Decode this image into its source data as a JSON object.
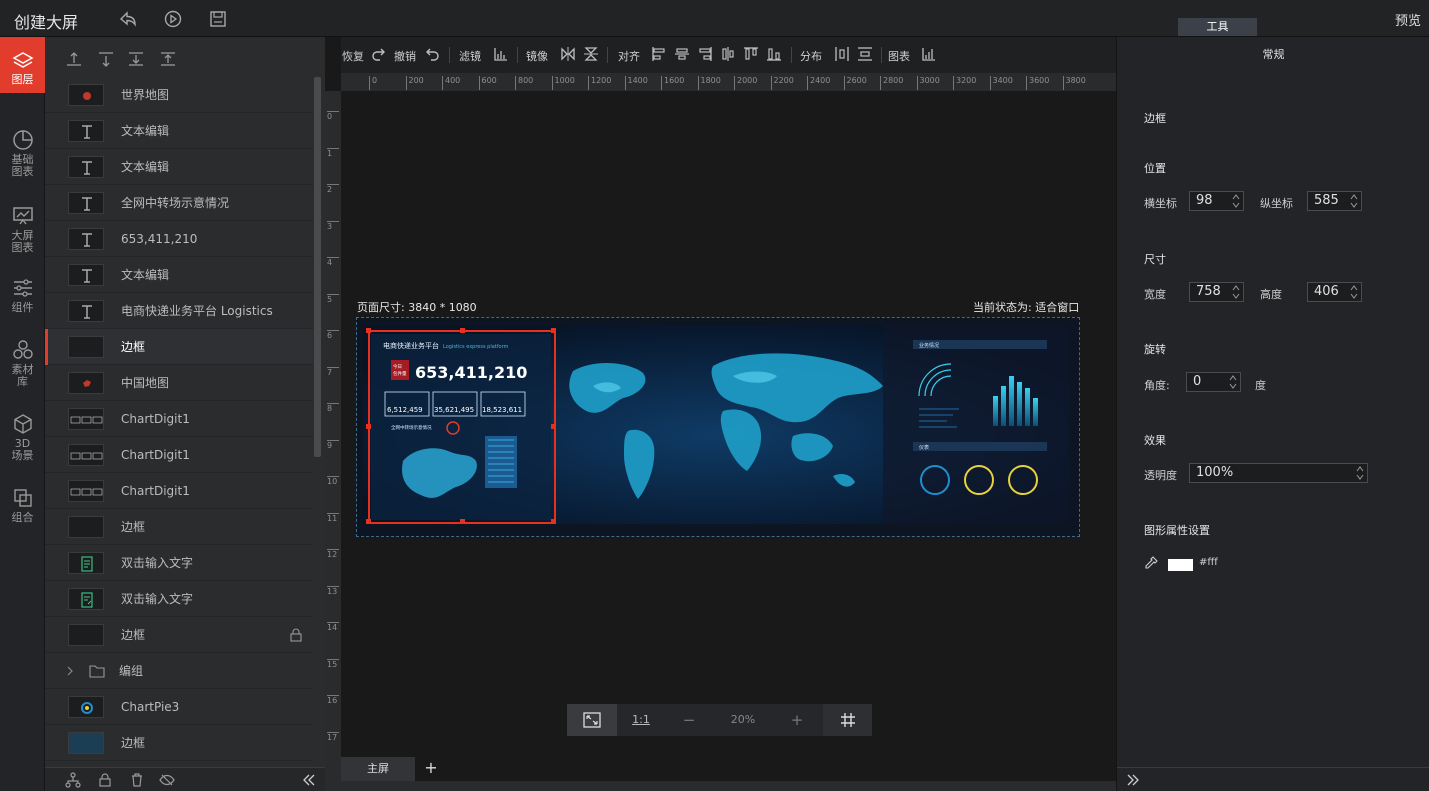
{
  "app": {
    "title": "创建大屏",
    "tools_tab": "工具",
    "preview": "预览"
  },
  "nav": [
    {
      "label": "图层"
    },
    {
      "label": "基础\n图表"
    },
    {
      "label": "大屏\n图表"
    },
    {
      "label": "组件"
    },
    {
      "label": "素材\n库"
    },
    {
      "label": "3D\n场景"
    },
    {
      "label": "组合"
    }
  ],
  "layers": [
    {
      "name": "世界地图",
      "thumb": "map-globe"
    },
    {
      "name": "文本编辑",
      "thumb": "text"
    },
    {
      "name": "文本编辑",
      "thumb": "text"
    },
    {
      "name": "全网中转场示意情况",
      "thumb": "text"
    },
    {
      "name": "653,411,210",
      "thumb": "text"
    },
    {
      "name": "文本编辑",
      "thumb": "text"
    },
    {
      "name": "电商快递业务平台 Logistics",
      "thumb": "text"
    },
    {
      "name": "边框",
      "thumb": "frame",
      "selected": true
    },
    {
      "name": "中国地图",
      "thumb": "map-china"
    },
    {
      "name": "ChartDigit1",
      "thumb": "digits"
    },
    {
      "name": "ChartDigit1",
      "thumb": "digits"
    },
    {
      "name": "ChartDigit1",
      "thumb": "digits"
    },
    {
      "name": "边框",
      "thumb": "frame"
    },
    {
      "name": "双击输入文字",
      "thumb": "doc"
    },
    {
      "name": "双击输入文字",
      "thumb": "doc2"
    },
    {
      "name": "边框",
      "thumb": "frame",
      "locked": true
    },
    {
      "name": "编组",
      "thumb": "group"
    },
    {
      "name": "ChartPie3",
      "thumb": "pie"
    },
    {
      "name": "边框",
      "thumb": "frame-blue"
    }
  ],
  "toolbar": {
    "redo": "恢复",
    "undo": "撤销",
    "filter": "滤镜",
    "mirror": "镜像",
    "align": "对齐",
    "distribute": "分布",
    "chart": "图表"
  },
  "ruler": {
    "top": [
      "0",
      "200",
      "400",
      "600",
      "800",
      "1000",
      "1200",
      "1400",
      "1600",
      "1800",
      "2000",
      "2200",
      "2400",
      "2600",
      "2800",
      "3000",
      "3200",
      "3400",
      "3600",
      "3800"
    ],
    "left": [
      "0",
      "1",
      "2",
      "3",
      "4",
      "5",
      "6",
      "7",
      "8",
      "9",
      "10",
      "11",
      "12",
      "13",
      "14",
      "15",
      "16",
      "17"
    ]
  },
  "canvas": {
    "page_size": "页面尺寸: 3840 * 1080",
    "current_state": "当前状态为: 适合窗口",
    "zoom": "20%",
    "one_to_one": "1:1",
    "minus": "−",
    "plus": "+",
    "tab_main": "主屏",
    "tab_add": "+"
  },
  "dashboard": {
    "title": "电商快递业务平台",
    "subtitle": "Logistics express platform",
    "badge": "今日\n包件量",
    "total": "653,411,210",
    "kpis": [
      "6,512,459",
      "35,621,495",
      "18,523,611"
    ],
    "map_caption": "全网中转场示意情况",
    "right_panel_title": "业务情况",
    "right_panel_title2": "仪表"
  },
  "props": {
    "tab": "常规",
    "border": "边框",
    "position": "位置",
    "x_label": "横坐标",
    "x_value": "98",
    "y_label": "纵坐标",
    "y_value": "585",
    "size": "尺寸",
    "w_label": "宽度",
    "w_value": "758",
    "h_label": "高度",
    "h_value": "406",
    "rotate": "旋转",
    "angle_label": "角度:",
    "angle_value": "0",
    "angle_unit": "度",
    "effect": "效果",
    "opacity_label": "透明度",
    "opacity_value": "100%",
    "shape_props": "图形属性设置",
    "color_value": "#fff"
  }
}
